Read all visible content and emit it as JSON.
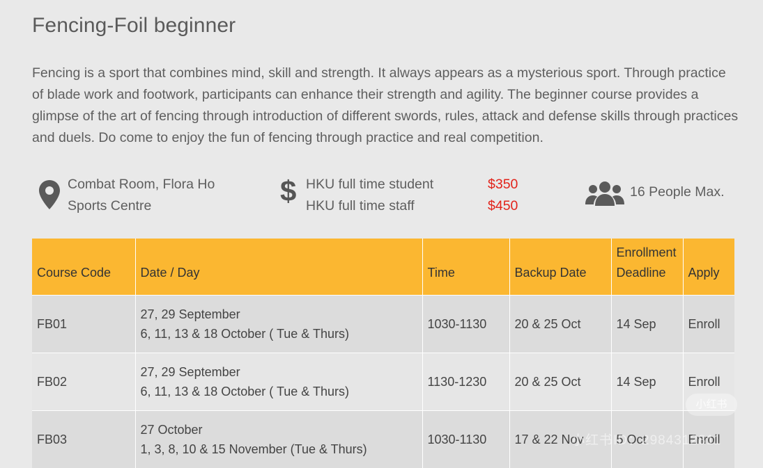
{
  "course": {
    "title": "Fencing-Foil beginner",
    "description": "Fencing is a sport that combines mind, skill and strength. It always appears as a mysterious sport. Through practice of blade work and footwork, participants can enhance their strength and agility. The beginner course provides a glimpse of the art of fencing through introduction of different swords, rules, attack and defense skills through practices and duels. Do come to enjoy the fun of fencing through practice and real competition."
  },
  "info": {
    "location_line1": "Combat Room, Flora Ho",
    "location_line2": "Sports Centre",
    "location_icon": "map-pin-icon",
    "price_icon": "dollar-icon",
    "price_student_label": "HKU full time student",
    "price_student_value": "$350",
    "price_staff_label": "HKU full time staff",
    "price_staff_value": "$450",
    "price_color": "#e2231a",
    "capacity_icon": "people-group-icon",
    "capacity": "16 People Max."
  },
  "table": {
    "header_color": "#fbb731",
    "headers": {
      "code": "Course Code",
      "date": "Date / Day",
      "time": "Time",
      "backup": "Backup Date",
      "deadline_1": "Enrollment",
      "deadline_2": "Deadline",
      "apply": "Apply"
    },
    "rows": [
      {
        "code": "FB01",
        "date_line1": "27, 29 September",
        "date_line2": "6, 11, 13 & 18 October ( Tue & Thurs)",
        "time": "1030-1130",
        "backup": "20 & 25 Oct",
        "deadline": "14 Sep",
        "apply": "Enroll"
      },
      {
        "code": "FB02",
        "date_line1": "27, 29 September",
        "date_line2": "6, 11, 13 & 18 October ( Tue & Thurs)",
        "time": "1130-1230",
        "backup": "20 & 25 Oct",
        "deadline": "14 Sep",
        "apply": "Enroll"
      },
      {
        "code": "FB03",
        "date_line1": "27 October",
        "date_line2": "1, 3, 8, 10 & 15 November (Tue & Thurs)",
        "time": "1030-1130",
        "backup": "17 & 22 Nov",
        "deadline": "5 Oct",
        "apply": "Enroll"
      }
    ]
  },
  "watermark": {
    "badge": "小红书",
    "text": "小红书ID：2984312811"
  }
}
